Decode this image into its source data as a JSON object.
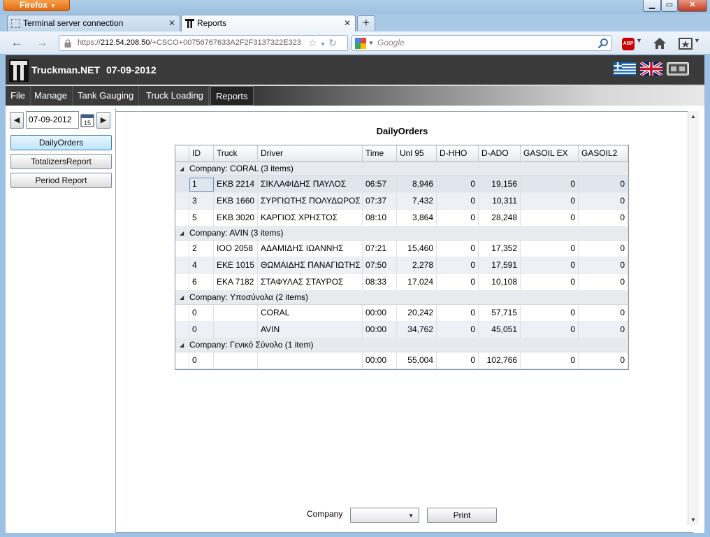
{
  "browser": {
    "menu_button": "Firefox",
    "tabs": [
      {
        "label": "Terminal server connection"
      },
      {
        "label": "Reports"
      }
    ],
    "url_prefix": "https://",
    "url_host": "212.54.208.50",
    "url_path": "/+CSCO+00756767633A2F2F3137322E323",
    "search_placeholder": "Google"
  },
  "app": {
    "title": "Truckman.NET",
    "date": "07-09-2012",
    "menu": [
      "File",
      "Manage",
      "Tank Gauging",
      "Truck Loading",
      "Reports"
    ],
    "active_menu": "Reports"
  },
  "sidebar": {
    "date_value": "07-09-2012",
    "calendar_day": "15",
    "buttons": [
      "DailyOrders",
      "TotalizersReport",
      "Period Report"
    ]
  },
  "report": {
    "title": "DailyOrders",
    "columns": [
      "ID",
      "Truck",
      "Driver",
      "Time",
      "Unl 95",
      "D-HHO",
      "D-ADO",
      "GASOIL EX",
      "GASOIL2"
    ],
    "groups": [
      {
        "label": "Company: CORAL (3 items)",
        "rows": [
          [
            "1",
            "EKB 2214",
            "ΣΙΚΛΑΦΙΔΗΣ ΠΑΥΛΟΣ",
            "06:57",
            "8,946",
            "0",
            "19,156",
            "0",
            "0"
          ],
          [
            "3",
            "EKB 1660",
            "ΣΥΡΓΙΩΤΗΣ ΠΟΛΥΔΩΡΟΣ",
            "07:37",
            "7,432",
            "0",
            "10,311",
            "0",
            "0"
          ],
          [
            "5",
            "EKB 3020",
            "ΚΑΡΓΙΟΣ ΧΡΗΣΤΟΣ",
            "08:10",
            "3,864",
            "0",
            "28,248",
            "0",
            "0"
          ]
        ]
      },
      {
        "label": "Company: AVIN (3 items)",
        "rows": [
          [
            "2",
            "IOO 2058",
            "ΑΔΑΜΙΔΗΣ ΙΩΑΝΝΗΣ",
            "07:21",
            "15,460",
            "0",
            "17,352",
            "0",
            "0"
          ],
          [
            "4",
            "EKE 1015",
            "ΘΩΜΑΙΔΗΣ ΠΑΝΑΓΙΩΤΗΣ",
            "07:50",
            "2,278",
            "0",
            "17,591",
            "0",
            "0"
          ],
          [
            "6",
            "EKA 7182",
            "ΣΤΑΦΥΛΑΣ ΣΤΑΥΡΟΣ",
            "08:33",
            "17,024",
            "0",
            "10,108",
            "0",
            "0"
          ]
        ]
      },
      {
        "label": "Company:  Υποσύνολα (2 items)",
        "rows": [
          [
            "0",
            "",
            "CORAL",
            "00:00",
            "20,242",
            "0",
            "57,715",
            "0",
            "0"
          ],
          [
            "0",
            "",
            "AVIN",
            "00:00",
            "34,762",
            "0",
            "45,051",
            "0",
            "0"
          ]
        ]
      },
      {
        "label": "Company:  Γενικό Σύνολο (1 item)",
        "rows": [
          [
            "0",
            "",
            "",
            "00:00",
            "55,004",
            "0",
            "102,766",
            "0",
            "0"
          ]
        ]
      }
    ],
    "company_label": "Company",
    "company_value": "",
    "print_label": "Print"
  }
}
